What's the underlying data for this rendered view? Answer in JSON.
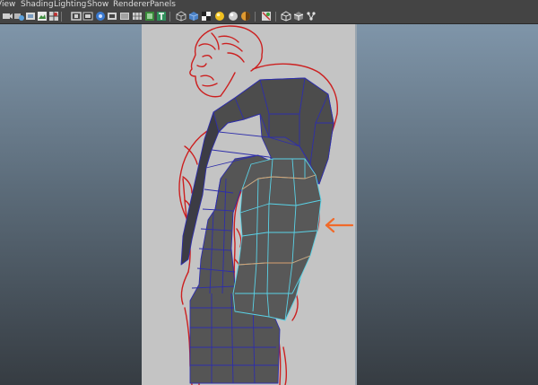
{
  "menubar": {
    "items": [
      {
        "label": "View"
      },
      {
        "label": "Shading"
      },
      {
        "label": "Lighting"
      },
      {
        "label": "Show"
      },
      {
        "label": "Renderer"
      },
      {
        "label": "Panels"
      }
    ]
  },
  "toolbar": {
    "icons": [
      "select-camera-icon",
      "camera-attributes-icon",
      "bookmarks-icon",
      "image-plane-icon",
      "grid-toggle-icon",
      "film-gate-icon",
      "resolution-gate-icon",
      "safe-action-icon",
      "safe-title-icon",
      "field-chart-icon",
      "wireframe-icon",
      "smooth-shade-icon",
      "checker-texture-icon",
      "default-light-icon",
      "all-lights-icon",
      "shadows-icon",
      "xray-icon",
      "isolate-select-icon",
      "wireframe-on-shaded-icon",
      "texture-icon"
    ]
  },
  "colors": {
    "menubar_bg": "#444444",
    "viewport_top": "#7f95a9",
    "viewport_bottom": "#363c42",
    "image_plane": "#c4c4c4",
    "sketch_lines": "#cc2020",
    "mesh_fill": "#535353",
    "mesh_edges": "#2e2eaa",
    "selected_edges": "#5ad2e6",
    "arrow": "#f06a2a"
  }
}
